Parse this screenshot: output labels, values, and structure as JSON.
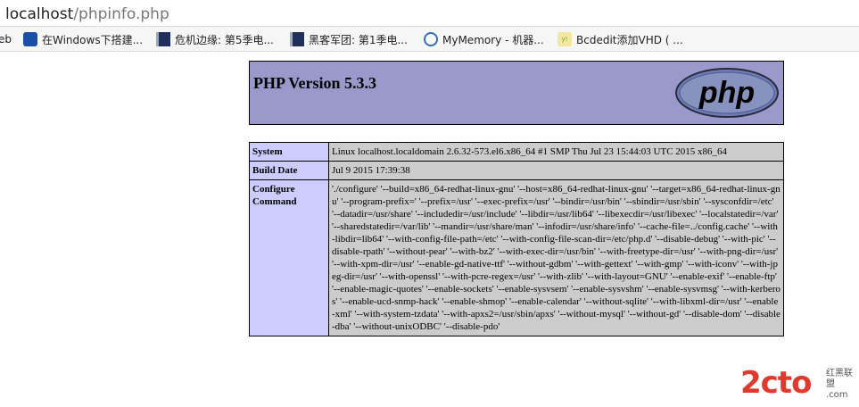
{
  "browser": {
    "address": {
      "host": "localhost",
      "path": "/phpinfo.php"
    },
    "bookmarks": [
      {
        "icon": "",
        "label": "eb"
      },
      {
        "icon": "paw-icon",
        "label": "在Windows下搭建..."
      },
      {
        "icon": "film-icon",
        "label": "危机边缘: 第5季电..."
      },
      {
        "icon": "film-icon",
        "label": "黑客军团: 第1季电..."
      },
      {
        "icon": "globe-icon",
        "label": "MyMemory - 机器..."
      },
      {
        "icon": "yahoo-icon",
        "label": "Bcdedit添加VHD ( ..."
      }
    ]
  },
  "phpinfo": {
    "title": "PHP Version 5.3.3",
    "logo_text": "php",
    "rows": [
      {
        "key": "System",
        "value": "Linux localhost.localdomain 2.6.32-573.el6.x86_64 #1 SMP Thu Jul 23 15:44:03 UTC 2015 x86_64"
      },
      {
        "key": "Build Date",
        "value": "Jul 9 2015 17:39:38"
      },
      {
        "key": "Configure Command",
        "value": "'./configure' '--build=x86_64-redhat-linux-gnu' '--host=x86_64-redhat-linux-gnu' '--target=x86_64-redhat-linux-gnu' '--program-prefix=' '--prefix=/usr' '--exec-prefix=/usr' '--bindir=/usr/bin' '--sbindir=/usr/sbin' '--sysconfdir=/etc' '--datadir=/usr/share' '--includedir=/usr/include' '--libdir=/usr/lib64' '--libexecdir=/usr/libexec' '--localstatedir=/var' '--sharedstatedir=/var/lib' '--mandir=/usr/share/man' '--infodir=/usr/share/info' '--cache-file=../config.cache' '--with-libdir=lib64' '--with-config-file-path=/etc' '--with-config-file-scan-dir=/etc/php.d' '--disable-debug' '--with-pic' '--disable-rpath' '--without-pear' '--with-bz2' '--with-exec-dir=/usr/bin' '--with-freetype-dir=/usr' '--with-png-dir=/usr' '--with-xpm-dir=/usr' '--enable-gd-native-ttf' '--without-gdbm' '--with-gettext' '--with-gmp' '--with-iconv' '--with-jpeg-dir=/usr' '--with-openssl' '--with-pcre-regex=/usr' '--with-zlib' '--with-layout=GNU' '--enable-exif' '--enable-ftp' '--enable-magic-quotes' '--enable-sockets' '--enable-sysvsem' '--enable-sysvshm' '--enable-sysvmsg' '--with-kerberos' '--enable-ucd-snmp-hack' '--enable-shmop' '--enable-calendar' '--without-sqlite' '--with-libxml-dir=/usr' '--enable-xml' '--with-system-tzdata' '--with-apxs2=/usr/sbin/apxs' '--without-mysql' '--without-gd' '--disable-dom' '--disable-dba' '--without-unixODBC' '--disable-pdo'"
      }
    ]
  },
  "watermark": {
    "main": "2cto",
    "sub1": "红黑联盟",
    "sub2": ".com"
  },
  "colors": {
    "header_bg": "#9999cc",
    "key_bg": "#ccccff",
    "value_bg": "#cccccc",
    "watermark": "#e03a2f"
  }
}
